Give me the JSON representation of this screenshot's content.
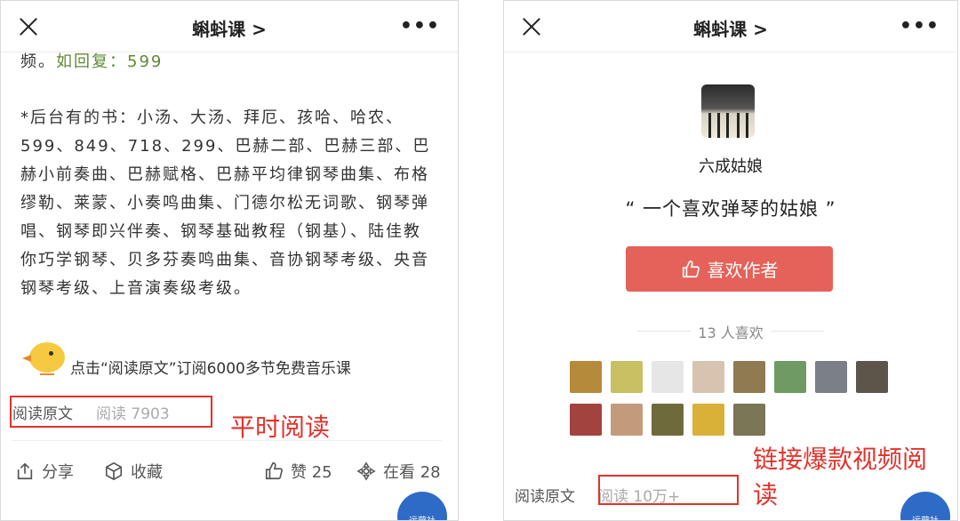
{
  "left": {
    "title": "蝌蚪课 >",
    "reply_prefix": "频。",
    "reply_highlight": "如回复：599",
    "books": "*后台有的书：小汤、大汤、拜厄、孩哈、哈农、599、849、718、299、巴赫二部、巴赫三部、巴赫小前奏曲、巴赫赋格、巴赫平均律钢琴曲集、布格缪勒、莱蒙、小奏鸣曲集、门德尔松无词歌、钢琴弹唱、钢琴即兴伴奏、钢琴基础教程（钢基）、陆佳教你巧学钢琴、贝多芬奏鸣曲集、音协钢琴考级、央音钢琴考级、上音演奏级考级。",
    "promo": "点击“阅读原文”订阅6000多节免费音乐课",
    "read_original": "阅读原文",
    "read_count": "阅读 7903",
    "annotation": "平时阅读",
    "actions": {
      "share": "分享",
      "favorite": "收藏",
      "like": "赞 25",
      "watching": "在看 28"
    },
    "badge": "运营社"
  },
  "right": {
    "title": "蝌蚪课 >",
    "author_name": "六成姑娘",
    "quote": "“ 一个喜欢弹琴的姑娘 ”",
    "like_author": "喜欢作者",
    "likes_count": "13 人喜欢",
    "liker_colors": [
      "#b58a3a",
      "#c9c063",
      "#e6e6e6",
      "#d7c3b0",
      "#8f7a52",
      "#6f9a64",
      "#7b8088",
      "#5d554a",
      "#a2433f",
      "#c49b7a",
      "#6f6a3b",
      "#d9b038",
      "#7a7656"
    ],
    "read_original": "阅读原文",
    "read_count": "阅读 10万+",
    "annotation": "链接爆款视频阅读",
    "badge": "运营社"
  },
  "colors": {
    "accent_red": "#e0332c",
    "like_button": "#e4625a",
    "green_text": "#5f8a35"
  }
}
